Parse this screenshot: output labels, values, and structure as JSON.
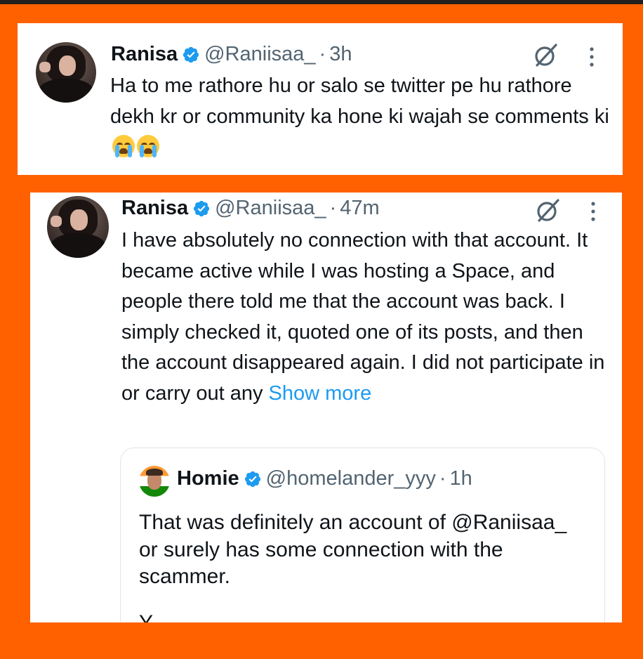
{
  "posts": [
    {
      "author_name": "Ranisa",
      "handle": "@Raniisaa_",
      "separator": "·",
      "time": "3h",
      "text": "Ha to me rathore hu or salo se twitter pe hu rathore dekh kr or community ka hone ki wajah se comments ki",
      "trailing_emojis": [
        "loudly-crying-face",
        "loudly-crying-face"
      ]
    },
    {
      "author_name": "Ranisa",
      "handle": "@Raniisaa_",
      "separator": "·",
      "time": "47m",
      "text": "I have absolutely no connection with that account. It became active while I was hosting a Space, and people there told me that the account was back. I simply checked it, quoted one of its posts, and then the account disappeared again. I did not participate in or carry out any ",
      "show_more": "Show more",
      "quoted_post": {
        "author_name": "Homie",
        "handle": "@homelander_yyy",
        "separator": "·",
        "time": "1h",
        "text": "That was definitely an account of @Raniisaa_  or surely has some connection with the scammer.",
        "text_cut": "Y"
      }
    }
  ],
  "icons": {
    "verified": "verified-badge-icon",
    "grok": "grok-icon",
    "more": "more-options-icon"
  },
  "colors": {
    "background": "#ff6100",
    "top_bar": "#231f1c",
    "card": "#ffffff",
    "text": "#0f1419",
    "secondary_text": "#536471",
    "link": "#1d9bf0",
    "verified": "#1d9bf0",
    "quote_border": "#dfe5ea"
  }
}
